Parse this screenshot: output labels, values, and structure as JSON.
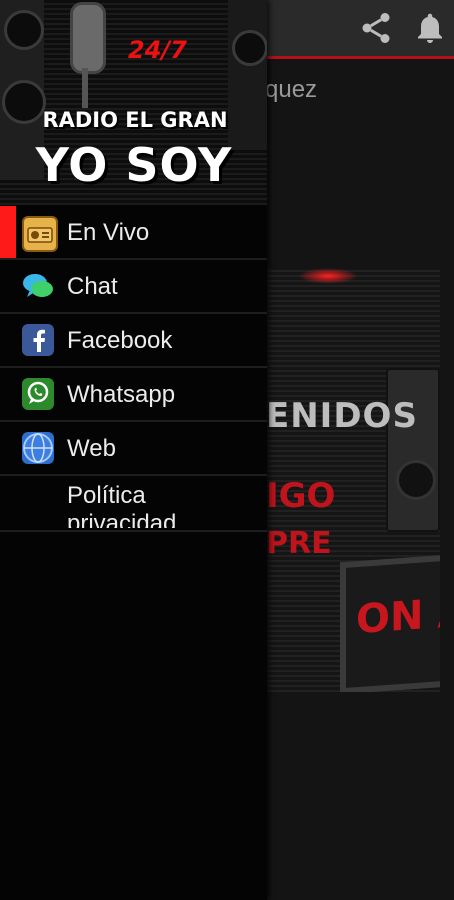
{
  "app": {
    "subtitle_partial": "quez",
    "actions": {
      "share_icon": "share-icon",
      "bell_icon": "bell-icon"
    },
    "promo": {
      "line1": "ENIDOS",
      "line2": "IGO",
      "line3": "PRE",
      "onair": "ON AI"
    }
  },
  "drawer": {
    "header": {
      "badge": "24/7",
      "brand_line1": "RADIO EL GRAN",
      "brand_line2": "YO SOY"
    },
    "items": [
      {
        "label": "En Vivo",
        "icon": "radio-icon",
        "active": true
      },
      {
        "label": "Chat",
        "icon": "chat-icon"
      },
      {
        "label": "Facebook",
        "icon": "facebook-icon"
      },
      {
        "label": "Whatsapp",
        "icon": "whatsapp-icon"
      },
      {
        "label": "Web",
        "icon": "web-icon"
      },
      {
        "label": "Política privacidad",
        "icon": ""
      }
    ]
  },
  "colors": {
    "accent": "#ff1a1a",
    "appbar": "#2a2a2a",
    "drawer": "#040404"
  }
}
